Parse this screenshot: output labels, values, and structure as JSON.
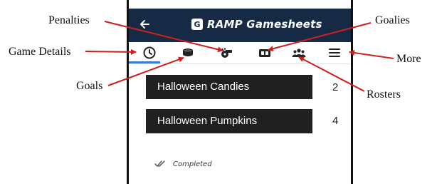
{
  "app": {
    "title": "RAMP Gamesheets",
    "logo_letter": "G"
  },
  "tabs": [
    {
      "name": "Game Details",
      "icon": "clock-icon"
    },
    {
      "name": "Goals",
      "icon": "puck-icon"
    },
    {
      "name": "Penalties",
      "icon": "whistle-icon"
    },
    {
      "name": "Goalies",
      "icon": "goalie-icon"
    },
    {
      "name": "Rosters",
      "icon": "people-icon"
    },
    {
      "name": "More",
      "icon": "menu-icon"
    }
  ],
  "teams": [
    {
      "name": "Halloween Candies",
      "score": "2"
    },
    {
      "name": "Halloween Pumpkins",
      "score": "4"
    }
  ],
  "status": {
    "text": "Completed",
    "icon": "double-check-icon"
  },
  "annotations": {
    "penalties": "Penalties",
    "goalies": "Goalies",
    "game_details": "Game Details",
    "more": "More",
    "goals": "Goals",
    "rosters": "Rosters"
  },
  "colors": {
    "appbar": "#172a45",
    "row": "#202020",
    "active_tab": "#3b7bd6",
    "annotation_arrow": "#cc1f1f"
  }
}
